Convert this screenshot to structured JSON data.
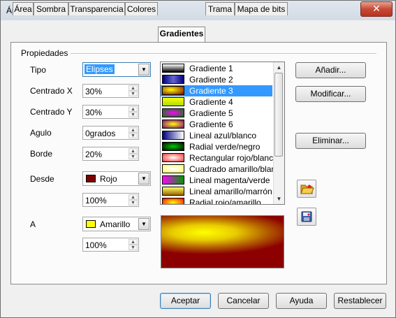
{
  "window": {
    "title": "Área",
    "close_label": "✕"
  },
  "tabs": [
    {
      "label": "Área"
    },
    {
      "label": "Sombra"
    },
    {
      "label": "Transparencia"
    },
    {
      "label": "Colores"
    },
    {
      "label": "Gradientes"
    },
    {
      "label": "Trama"
    },
    {
      "label": "Mapa de bits"
    }
  ],
  "properties": {
    "section_label": "Propiedades",
    "tipo": {
      "label": "Tipo",
      "value": "Elipses"
    },
    "centrado_x": {
      "label": "Centrado X",
      "value": "30%"
    },
    "centrado_y": {
      "label": "Centrado Y",
      "value": "30%"
    },
    "angulo": {
      "label": "Agulo",
      "value": "0grados"
    },
    "borde": {
      "label": "Borde",
      "value": "20%"
    },
    "desde": {
      "label": "Desde",
      "color_name": "Rojo",
      "color": "#800000",
      "intensity": "100%"
    },
    "a": {
      "label": "A",
      "color_name": "Amarillo",
      "color": "#ffff00",
      "intensity": "100%"
    }
  },
  "gradient_list": {
    "selected_index": 2,
    "items": [
      {
        "label": "Gradiente 1",
        "thumb": "linear-gradient(#ffffff,#000000)"
      },
      {
        "label": "Gradiente 2",
        "thumb": "linear-gradient(90deg,#000080,#6666cc,#000080)"
      },
      {
        "label": "Gradiente 3",
        "thumb": "radial-gradient(ellipse at 40% 40%,#ffff00,#800000)"
      },
      {
        "label": "Gradiente 4",
        "thumb": "linear-gradient(#ffff00,#aadd00)"
      },
      {
        "label": "Gradiente 5",
        "thumb": "radial-gradient(#ff00ff,#008000)"
      },
      {
        "label": "Gradiente 6",
        "thumb": "radial-gradient(#ffff00,#800080)"
      },
      {
        "label": "Lineal azul/blanco",
        "thumb": "linear-gradient(90deg,#000080,#ffffff)"
      },
      {
        "label": "Radial verde/negro",
        "thumb": "radial-gradient(#00cc00,#000000)"
      },
      {
        "label": "Rectangular rojo/blanco",
        "thumb": "radial-gradient(#ffffff,#ff3333)"
      },
      {
        "label": "Cuadrado amarillo/blanco",
        "thumb": "radial-gradient(#ffffff,#ffff66)"
      },
      {
        "label": "Lineal magenta/verde",
        "thumb": "linear-gradient(90deg,#ff00ff,#009900)"
      },
      {
        "label": "Lineal amarillo/marrón",
        "thumb": "linear-gradient(#ffff66,#996600)"
      },
      {
        "label": "Radial rojo/amarillo",
        "thumb": "radial-gradient(#ffff00,#ff0000)"
      }
    ]
  },
  "buttons": {
    "add": "Añadir...",
    "modify": "Modificar...",
    "delete": "Eliminar...",
    "ok": "Aceptar",
    "cancel": "Cancelar",
    "help": "Ayuda",
    "reset": "Restablecer"
  },
  "icons": {
    "open": "open-folder-icon",
    "save": "save-disk-icon"
  },
  "colors": {
    "selection": "#3399ff",
    "titlebar": "#d9e1ea"
  }
}
